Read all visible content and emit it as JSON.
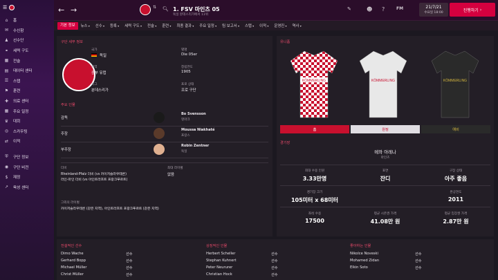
{
  "sidebar": {
    "items": [
      {
        "label": "홈",
        "icon": "home-icon"
      },
      {
        "label": "수신함",
        "icon": "inbox-icon"
      },
      {
        "label": "선수단",
        "icon": "squad-icon"
      },
      {
        "label": "세력 구도",
        "icon": "dynamics-icon"
      },
      {
        "label": "전술",
        "icon": "tactics-icon"
      },
      {
        "label": "데이터 센터",
        "icon": "data-hub-icon"
      },
      {
        "label": "스탭",
        "icon": "staff-icon"
      },
      {
        "label": "훈련",
        "icon": "training-icon"
      },
      {
        "label": "의료 센터",
        "icon": "medical-icon"
      },
      {
        "label": "주요 일정",
        "icon": "schedule-icon"
      },
      {
        "label": "대회",
        "icon": "competitions-icon"
      },
      {
        "label": "스카우팅",
        "icon": "scouting-icon"
      },
      {
        "label": "이적",
        "icon": "transfers-icon"
      },
      {
        "label": "구단 정보",
        "icon": "club-info-icon"
      },
      {
        "label": "구단 비전",
        "icon": "club-vision-icon"
      },
      {
        "label": "재정",
        "icon": "finances-icon"
      },
      {
        "label": "육성 센터",
        "icon": "dev-centre-icon"
      }
    ]
  },
  "header": {
    "title": "1. FSV 마인츠 05",
    "subtitle": "독일 분데스리가에서 11위",
    "date_line1": "21/7/21",
    "date_line2": "수요일 18:00",
    "continue_label": "진행하기",
    "fm_label": "FM"
  },
  "tabs": [
    {
      "label": "기본 정보",
      "active": true
    },
    {
      "label": "뉴스"
    },
    {
      "label": "선수"
    },
    {
      "label": "등록"
    },
    {
      "label": "세력 구도"
    },
    {
      "label": "전술"
    },
    {
      "label": "훈련"
    },
    {
      "label": "최종 결과"
    },
    {
      "label": "주요 일정"
    },
    {
      "label": "팀 보고서"
    },
    {
      "label": "스탭"
    },
    {
      "label": "이적"
    },
    {
      "label": "운영진"
    },
    {
      "label": "역사"
    }
  ],
  "club_info": {
    "section_title": "구단 세부 정보",
    "nation_label": "국가",
    "nation_value": "독일",
    "city_label": "지역",
    "city_value": "Die 05er",
    "city_label2": "별명",
    "region_label": "지역",
    "region_value": "중부 유럽",
    "founded_label": "창립연도",
    "founded_value": "1905",
    "league_label": "리그",
    "league_value": "분데스리가",
    "status_label": "프로 상태",
    "status_value": "프로 구단"
  },
  "key_people": {
    "section_title": "주요 인물",
    "rows": [
      {
        "role": "감독",
        "name": "Bo Svensson",
        "nation": "덴마크"
      },
      {
        "role": "주장",
        "name": "Moussa Niakhaté",
        "nation": "프랑스"
      },
      {
        "role": "부주장",
        "name": "Robin Zentner",
        "nation": "독일"
      }
    ]
  },
  "derby": {
    "label": "더비",
    "line1": "Rheinland-Pfalz 더비 (vs 카이저슬라우테른)",
    "line2": "라인-마인 더비 (vs 아인트라흐트 프랑크푸르트)",
    "biggest_label": "최대 라이벌",
    "biggest_value": "없음",
    "rivals_label": "그외의 라이벌",
    "rivals_value": "카이저슬라우테른 (같은 지역), 아인트라흐트 프랑크푸르트 (같은 지역)"
  },
  "kits": {
    "section_title": "유니폼",
    "sponsor": "KÖMMERLING",
    "home_label": "홈",
    "away_label": "원정",
    "third_label": "예비",
    "home_color": "#c8102e",
    "away_color": "#e8e8e8",
    "third_color": "#2a2a2a"
  },
  "stadium": {
    "section_title": "경기장",
    "name": "메와 아레나",
    "city": "마인츠",
    "capacity_label": "최대 수용 인원",
    "capacity_value": "3.33만명",
    "surface_label": "표면",
    "surface_value": "잔디",
    "condition_label": "구장 상태",
    "condition_value": "아주 좋음",
    "pitch_label": "경기장 크기",
    "pitch_value": "105미터 x 68미터",
    "built_label": "완공연도",
    "built_value": "2011",
    "seated_label": "좌석 수용",
    "seated_value": "17500",
    "avg_att_label": "평균 시즌권 가격",
    "avg_att_value": "41.08만 원",
    "avg_price_label": "평균 입장권 가격",
    "avg_price_value": "2.87만 원"
  },
  "bottom": {
    "col1_title": "전설적인 선수",
    "col1": [
      {
        "name": "Dimo Wache",
        "pos": "선수"
      },
      {
        "name": "Gerhard Bopp",
        "pos": "선수"
      },
      {
        "name": "Michael Müller",
        "pos": "선수"
      },
      {
        "name": "Christ Müller",
        "pos": "선수"
      }
    ],
    "col2_title": "상징적인 인물",
    "col2": [
      {
        "name": "Herbert Scheller",
        "pos": "선수"
      },
      {
        "name": "Stephan Kuhnert",
        "pos": "선수"
      },
      {
        "name": "Peter Neururer",
        "pos": "선수"
      },
      {
        "name": "Christian Hock",
        "pos": "선수"
      }
    ],
    "col3_title": "좋아하는 인물",
    "col3": [
      {
        "name": "Nikolce Noveski",
        "pos": "선수"
      },
      {
        "name": "Mohamed Zidan",
        "pos": "선수"
      },
      {
        "name": "Elkin Soto",
        "pos": "선수"
      }
    ]
  },
  "colors": {
    "accent": "#d5003f",
    "club_red": "#c8102e"
  }
}
